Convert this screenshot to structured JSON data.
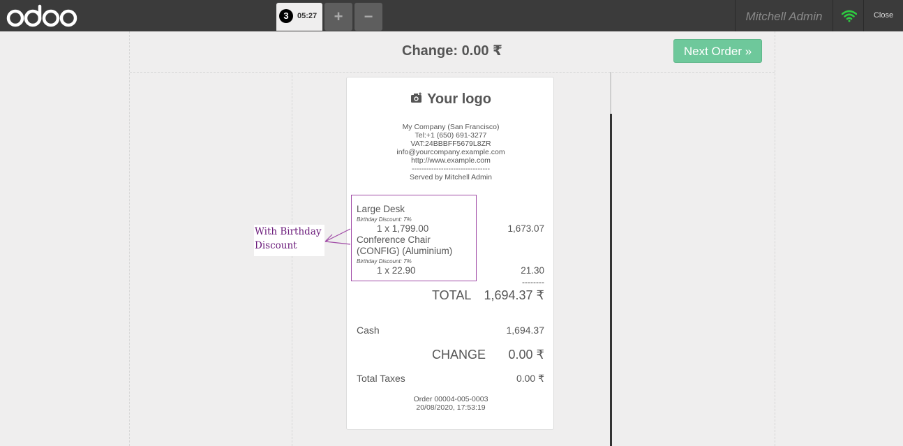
{
  "topbar": {
    "logo_text": "odoo",
    "order_badge": "3",
    "order_time": "05:27",
    "add_label": "+",
    "remove_label": "−",
    "user_name": "Mitchell Admin",
    "close_label": "Close",
    "wifi_icon": "wifi-icon",
    "wifi_color": "#2ecc40"
  },
  "screen": {
    "change_title": "Change: 0.00 ₹",
    "next_order_label": "Next Order »",
    "next_order_color": "#6ec89b"
  },
  "receipt": {
    "logo_text": "Your logo",
    "header_lines": [
      "My Company (San Francisco)",
      "Tel:+1 (650) 691-3277",
      "VAT:24BBBFF5679L8ZR",
      "info@yourcompany.example.com",
      "http://www.example.com",
      "--------------------------------",
      "Served by Mitchell Admin"
    ],
    "lines": [
      {
        "name": "Large Desk",
        "discount": "Birthday Discount: 7%",
        "qty": "1 x 1,799.00",
        "amount": "1,673.07"
      },
      {
        "name_line1": "Conference Chair",
        "name_line2": "(CONFIG) (Aluminium)",
        "discount": "Birthday Discount: 7%",
        "qty": "1 x 22.90",
        "amount": "21.30"
      }
    ],
    "separator": "--------",
    "total_label": "TOTAL",
    "total_value": "1,694.37 ₹",
    "cash_label": "Cash",
    "cash_value": "1,694.37",
    "change_label": "CHANGE",
    "change_value": "0.00 ₹",
    "taxes_label": "Total Taxes",
    "taxes_value": "0.00 ₹",
    "order_ref": "Order 00004-005-0003",
    "order_date": "20/08/2020, 17:53:19"
  },
  "annotation": {
    "line1": "With  Birthday",
    "line2": "Discount",
    "color": "#a04aa6"
  }
}
